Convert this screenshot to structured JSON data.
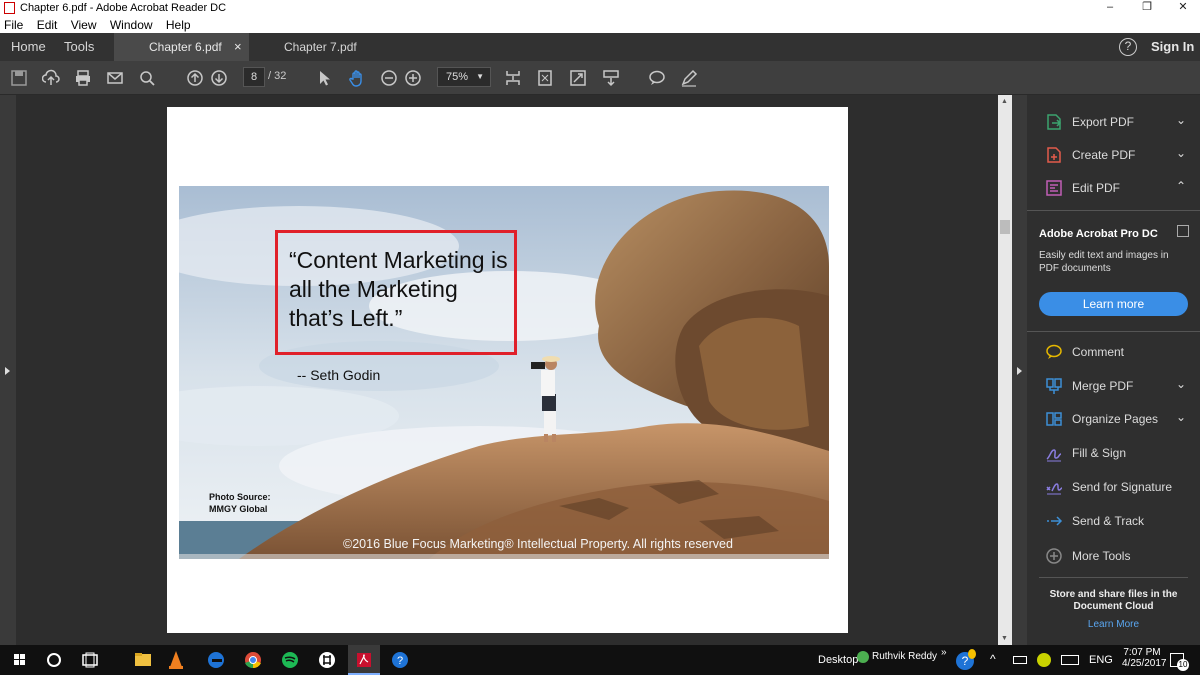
{
  "window": {
    "title": "Chapter 6.pdf - Adobe Acrobat Reader DC",
    "controls": [
      "–",
      "❐",
      "✕"
    ]
  },
  "menu": [
    "File",
    "Edit",
    "View",
    "Window",
    "Help"
  ],
  "tabs": {
    "home": "Home",
    "tools": "Tools",
    "docs": [
      {
        "label": "Chapter 6.pdf",
        "close": "×"
      },
      {
        "label": "Chapter 7.pdf",
        "close": ""
      }
    ],
    "help_icon": "?",
    "signin": "Sign In"
  },
  "toolbar": {
    "page_current": "8",
    "page_total": "/ 32",
    "zoom": "75%"
  },
  "document": {
    "quote": "“Content Marketing is all the Marketing that’s Left.”",
    "quote_lines": [
      "“Content Marketing is",
      "all the Marketing",
      "that’s Left.”"
    ],
    "author": "--  Seth Godin",
    "photo_source": [
      "Photo Source:",
      "MMGY Global"
    ],
    "copyright": "©2016 Blue Focus Marketing® Intellectual Property. All rights reserved"
  },
  "right_panel": {
    "tools_top": [
      {
        "label": "Export PDF",
        "chevron": "⌄",
        "color": "#3ca36f"
      },
      {
        "label": "Create PDF",
        "chevron": "⌄",
        "color": "#e35b4b"
      },
      {
        "label": "Edit PDF",
        "chevron": "⌃",
        "color": "#c05fb5"
      }
    ],
    "promo": {
      "title": "Adobe Acrobat Pro DC",
      "desc": "Easily edit text and images in PDF documents",
      "button": "Learn more"
    },
    "tools_bottom": [
      {
        "label": "Comment",
        "chevron": "",
        "color": "#e6b800"
      },
      {
        "label": "Merge PDF",
        "chevron": "⌄",
        "color": "#3d8fd6"
      },
      {
        "label": "Organize Pages",
        "chevron": "⌄",
        "color": "#3d8fd6"
      },
      {
        "label": "Fill & Sign",
        "chevron": "",
        "color": "#8a7de0"
      },
      {
        "label": "Send for Signature",
        "chevron": "",
        "color": "#8a7de0"
      },
      {
        "label": "Send & Track",
        "chevron": "",
        "color": "#3d8fd6"
      },
      {
        "label": "More Tools",
        "chevron": "",
        "color": "#888888"
      }
    ],
    "cloud": {
      "text": "Store and share files in the Document Cloud",
      "link": "Learn More"
    }
  },
  "taskbar": {
    "desktop": "Desktop",
    "user": "Ruthvik Reddy",
    "language": "ENG",
    "time": "7:07 PM",
    "date": "4/25/2017",
    "notif_count": "10"
  },
  "colors": {
    "accent_blue": "#3a8ee6",
    "quote_box": "#e0202a"
  }
}
